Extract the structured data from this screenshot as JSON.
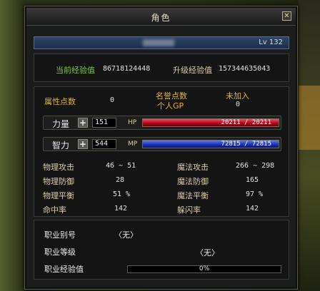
{
  "window": {
    "title": "角色",
    "close_symbol": "✕"
  },
  "character": {
    "level": "Lv 132"
  },
  "exp": {
    "current_label": "当前经验值",
    "current_value": "86718124448",
    "upgrade_label": "升级经验值",
    "upgrade_value": "157344635043"
  },
  "points": {
    "attr_label": "属性点数",
    "attr_value": "0",
    "fame_label": "名誉点数",
    "gp_label": "个人GP",
    "guild_status": "未加入",
    "gp_value": "0"
  },
  "stats": {
    "str_label": "力量",
    "str_value": "151",
    "hp_label": "HP",
    "hp_text": "20211 / 20211",
    "hp_fraction": 1.0,
    "int_label": "智力",
    "int_value": "544",
    "mp_label": "MP",
    "mp_text": "72815 / 72815",
    "mp_fraction": 1.0
  },
  "combat": {
    "phys_atk_label": "物理攻击",
    "phys_atk_value": "46 ~ 51",
    "mag_atk_label": "魔法攻击",
    "mag_atk_value": "266 ~ 298",
    "phys_def_label": "物理防御",
    "phys_def_value": "28",
    "mag_def_label": "魔法防御",
    "mag_def_value": "165",
    "phys_bal_label": "物理平衡",
    "phys_bal_value": "51 %",
    "mag_bal_label": "魔法平衡",
    "mag_bal_value": "97 %",
    "hit_label": "命中率",
    "hit_value": "142",
    "dodge_label": "躲闪率",
    "dodge_value": "142"
  },
  "job": {
    "type_label": "职业别号",
    "type_value": "〈无〉",
    "level_label": "职业等级",
    "level_value": "〈无〉",
    "exp_label": "职业经验值",
    "exp_text": "0%",
    "exp_fraction": 0
  },
  "colors": {
    "hp": "#c8102a",
    "mp": "#1c3aa6",
    "label_gold": "#e6b42a",
    "exp_green": "#7ec24a"
  }
}
